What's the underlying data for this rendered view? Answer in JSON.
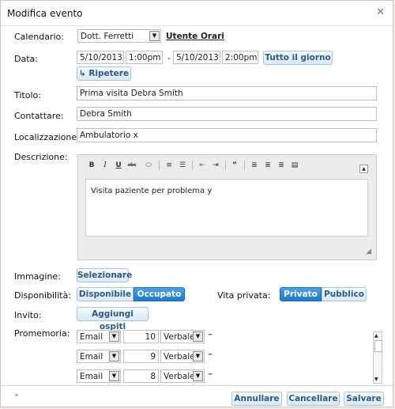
{
  "dialog": {
    "title": "Modifica evento"
  },
  "calendar": {
    "label": "Calendario:",
    "value": "Dott. Ferretti",
    "link": "Utente Orari"
  },
  "date": {
    "label": "Data:",
    "start_date": "5/10/2013",
    "start_time": "1:00pm",
    "separator": "-",
    "end_date": "5/10/2013",
    "end_time": "2:00pm",
    "all_day": "Tutto il giorno",
    "repeat": "Ripetere",
    "repeat_icon": "↳"
  },
  "titolo": {
    "label": "Titolo:",
    "value": "Prima visita Debra Smith"
  },
  "contattare": {
    "label": "Contattare:",
    "value": "Debra  Smith"
  },
  "localizzazione": {
    "label": "Localizzazione:",
    "value": "Ambulatorio x"
  },
  "descrizione": {
    "label": "Descrizione:",
    "content": "Visita paziente per problema y"
  },
  "immagine": {
    "label": "Immagine:",
    "button": "Selezionare"
  },
  "disponibilita": {
    "label": "Disponibilità:",
    "options": [
      "Disponibile",
      "Occupato"
    ],
    "selected": "Occupato"
  },
  "vita_privata": {
    "label": "Vita privata:",
    "options": [
      "Privato",
      "Pubblico"
    ],
    "selected": "Privato"
  },
  "invito": {
    "label": "Invito:",
    "button": "Aggiungi ospiti"
  },
  "promemoria": {
    "label": "Promemoria:",
    "rows": [
      {
        "type": "Email",
        "amount": "10",
        "mode": "Verbale"
      },
      {
        "type": "Email",
        "amount": "9",
        "mode": "Verbale"
      },
      {
        "type": "Email",
        "amount": "8",
        "mode": "Verbale"
      }
    ]
  },
  "footer": {
    "collapse": "ˆ",
    "cancel": "Annullare",
    "delete": "Cancellare",
    "save": "Salvare"
  },
  "colors": {
    "accent": "#1f78c9",
    "button_text": "#2a5a8a"
  }
}
